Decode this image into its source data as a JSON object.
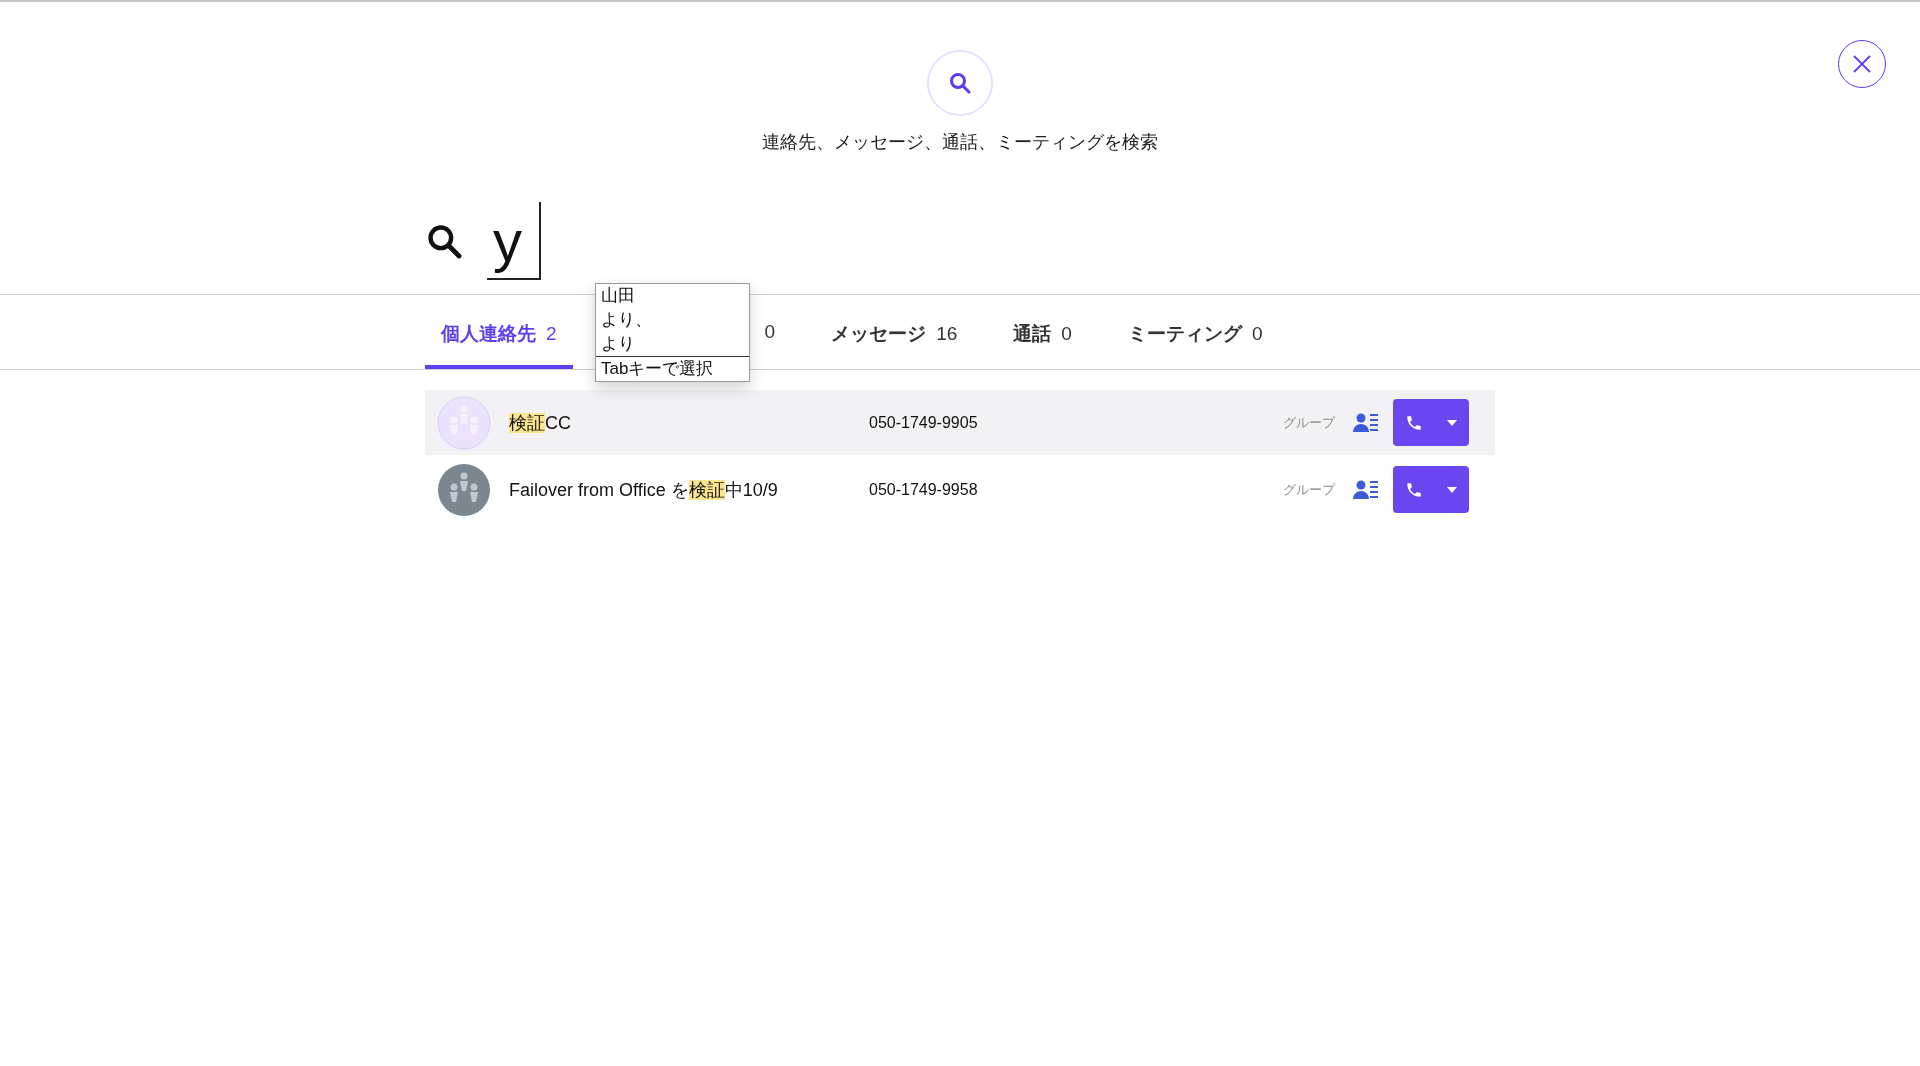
{
  "header": {
    "subtitle": "連絡先、メッセージ、通話、ミーティングを検索"
  },
  "search": {
    "value": "y"
  },
  "ime_candidates": {
    "items": [
      {
        "text": "山田",
        "selected": false
      },
      {
        "text": "より、",
        "selected": false
      },
      {
        "text": "より",
        "selected": false
      }
    ],
    "hint": "Tabキーで選択"
  },
  "tabs": [
    {
      "label": "個人連絡先",
      "count": "2",
      "selected": true
    },
    {
      "count": "0",
      "selected": false
    },
    {
      "label": "メッセージ",
      "count": "16",
      "selected": false
    },
    {
      "label": "通話",
      "count": "0",
      "selected": false
    },
    {
      "label": "ミーティング",
      "count": "0",
      "selected": false
    }
  ],
  "results": [
    {
      "name": [
        {
          "text": "検証",
          "highlight": true
        },
        {
          "text": "CC",
          "highlight": false
        }
      ],
      "phone": "050-1749-9905",
      "type": "グループ",
      "color": "#ebe3fb",
      "selected": true
    },
    {
      "name": [
        {
          "text": "Failover from Office を",
          "highlight": false
        },
        {
          "text": "検証",
          "highlight": true
        },
        {
          "text": "中10/9",
          "highlight": false
        }
      ],
      "phone": "050-1749-9958",
      "type": "グループ",
      "color": "#7a8690",
      "selected": false
    }
  ]
}
